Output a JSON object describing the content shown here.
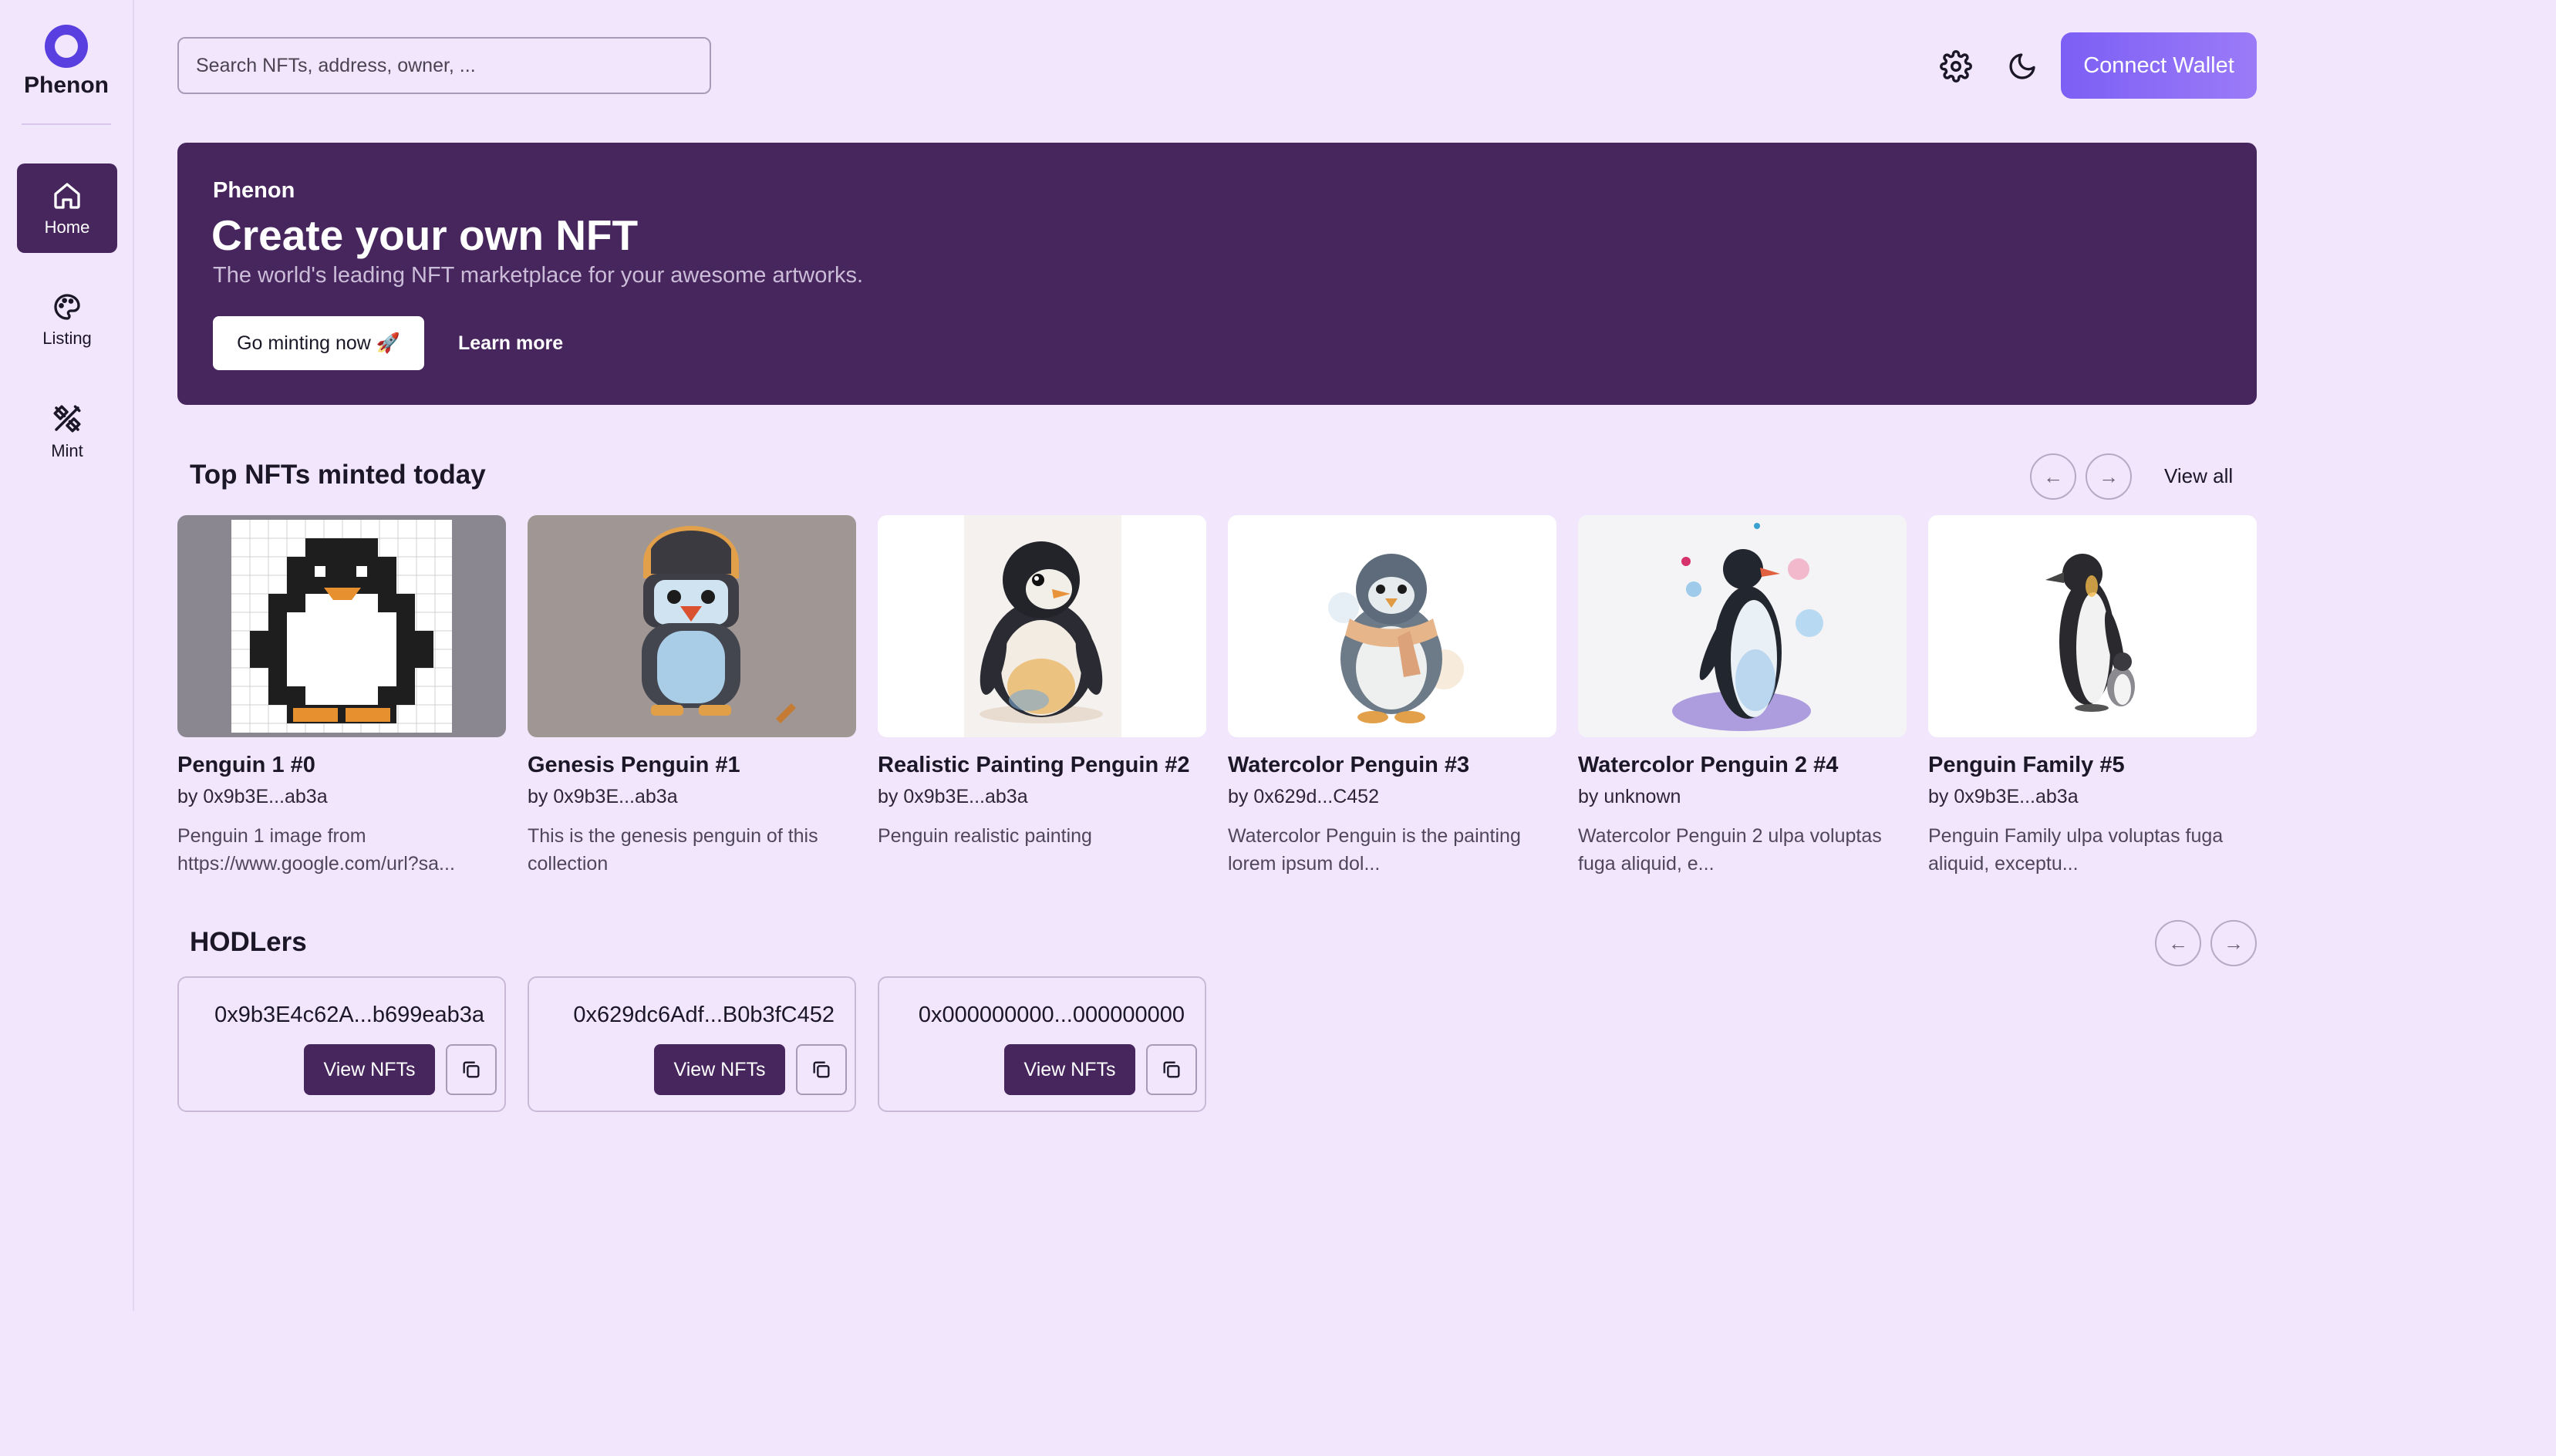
{
  "app": {
    "name": "Phenon"
  },
  "sidebar": {
    "items": [
      {
        "label": "Home",
        "icon": "home-icon",
        "active": true
      },
      {
        "label": "Listing",
        "icon": "palette-icon",
        "active": false
      },
      {
        "label": "Mint",
        "icon": "tools-icon",
        "active": false
      }
    ]
  },
  "header": {
    "search_placeholder": "Search NFTs, address, owner, ...",
    "settings_icon": "gear-icon",
    "theme_icon": "moon-icon",
    "connect_label": "Connect Wallet"
  },
  "hero": {
    "eyebrow": "Phenon",
    "title": "Create your own NFT",
    "subtitle": "The world's leading NFT marketplace for your awesome artworks.",
    "primary_label": "Go minting now 🚀",
    "secondary_label": "Learn more"
  },
  "top_nfts": {
    "title": "Top NFTs minted today",
    "view_all_label": "View all",
    "items": [
      {
        "title": "Penguin 1 #0",
        "owner": "by 0x9b3E...ab3a",
        "desc_line1": "Penguin 1 image from",
        "desc_line2": "https://www.google.com/url?sa..."
      },
      {
        "title": "Genesis Penguin #1",
        "owner": "by 0x9b3E...ab3a",
        "desc_line1": "This is the genesis penguin of this",
        "desc_line2": "collection"
      },
      {
        "title": "Realistic Painting Penguin #2",
        "owner": "by 0x9b3E...ab3a",
        "desc_line1": "Penguin realistic painting",
        "desc_line2": ""
      },
      {
        "title": "Watercolor Penguin #3",
        "owner": "by 0x629d...C452",
        "desc_line1": "Watercolor Penguin is the painting",
        "desc_line2": "lorem ipsum dol..."
      },
      {
        "title": "Watercolor Penguin 2 #4",
        "owner": "by unknown",
        "desc_line1": "Watercolor Penguin 2 ulpa voluptas",
        "desc_line2": "fuga aliquid, e..."
      },
      {
        "title": "Penguin Family #5",
        "owner": "by 0x9b3E...ab3a",
        "desc_line1": "Penguin Family ulpa voluptas fuga",
        "desc_line2": "aliquid, exceptu..."
      }
    ]
  },
  "holders": {
    "title": "HODLers",
    "view_label": "View NFTs",
    "items": [
      {
        "address": "0x9b3E4c62A...b699eab3a"
      },
      {
        "address": "0x629dc6Adf...B0b3fC452"
      },
      {
        "address": "0x000000000...000000000"
      }
    ]
  },
  "colors": {
    "page_bg": "#f2e6fc",
    "primary": "#47265e",
    "accent": "#7c5ff5"
  }
}
